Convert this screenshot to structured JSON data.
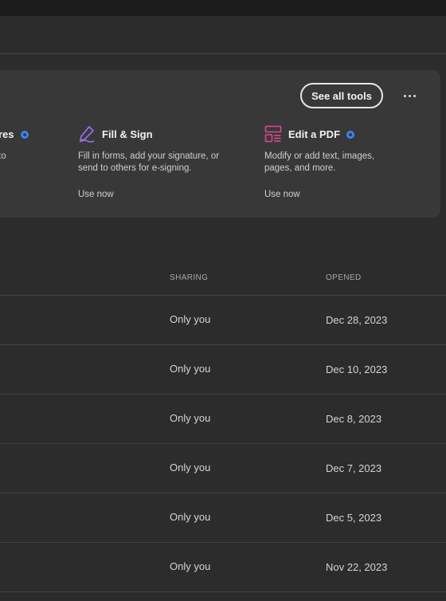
{
  "toolbar": {
    "see_all_tools_label": "See all tools",
    "more_icon": "ellipsis-icon"
  },
  "tools": [
    {
      "name": "res",
      "description": "to",
      "icon": "signatures-icon",
      "premium": true
    },
    {
      "name": "Fill & Sign",
      "description": "Fill in forms, add your signature, or send to others for e-signing.",
      "action": "Use now",
      "icon": "fill-sign-pen-icon",
      "icon_color": "#9a6be0",
      "premium": false
    },
    {
      "name": "Edit a PDF",
      "description": "Modify or add text, images, pages, and more.",
      "action": "Use now",
      "icon": "edit-pdf-icon",
      "icon_color": "#e0459b",
      "premium": true
    }
  ],
  "table": {
    "headers": {
      "sharing": "SHARING",
      "opened": "OPENED"
    },
    "rows": [
      {
        "sharing": "Only you",
        "opened": "Dec 28, 2023"
      },
      {
        "sharing": "Only you",
        "opened": "Dec 10, 2023"
      },
      {
        "sharing": "Only you",
        "opened": "Dec 8, 2023"
      },
      {
        "sharing": "Only you",
        "opened": "Dec 7, 2023"
      },
      {
        "sharing": "Only you",
        "opened": "Dec 5, 2023"
      },
      {
        "sharing": "Only you",
        "opened": "Nov 22, 2023"
      }
    ]
  },
  "colors": {
    "background": "#2c2c2c",
    "card": "#383838",
    "premium_badge": "#3b82f6"
  }
}
